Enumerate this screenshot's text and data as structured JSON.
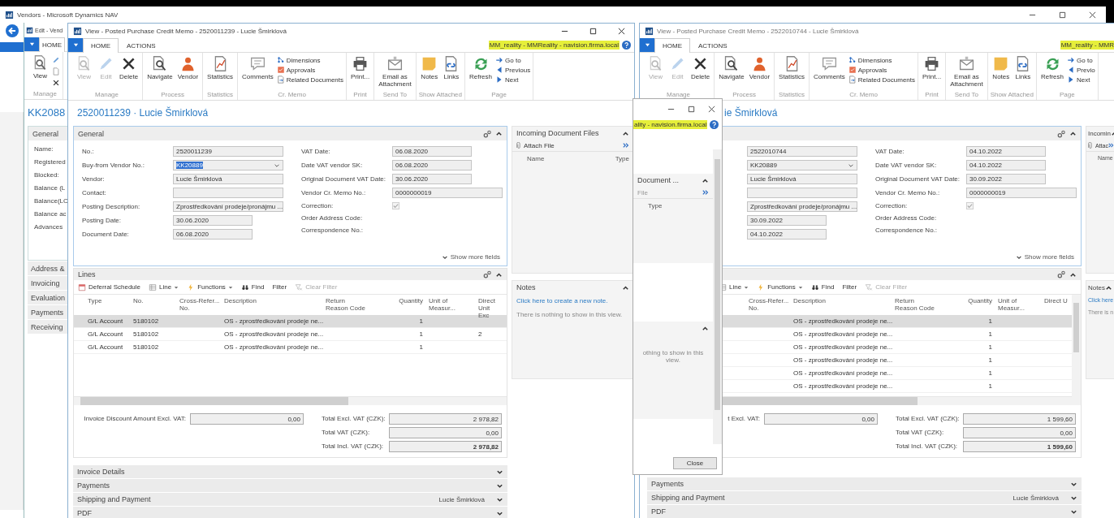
{
  "outer_window": {
    "title": "Vendors - Microsoft Dynamics NAV"
  },
  "vendor_window": {
    "title": "Edit - Vend",
    "tabs": [
      {
        "label": "HOME",
        "selected": true
      }
    ],
    "button": {
      "kind": "view",
      "label": "View"
    },
    "group": "Manage",
    "record": "KK2088",
    "heading": "General",
    "labels": [
      "Name:",
      "Registered",
      "Blocked:",
      "Balance (L",
      "Balance(LC",
      "Balance ac",
      "Advances"
    ],
    "sections": [
      "Address &",
      "Invoicing",
      "Evaluation",
      "Payments",
      "Receiving"
    ]
  },
  "memos": [
    {
      "title": "View - Posted Purchase Credit Memo - 2520011239 - Lucie Šmirklová",
      "tabs": [
        {
          "label": "HOME",
          "selected": true
        },
        {
          "label": "ACTIONS",
          "selected": false
        }
      ],
      "connection": "MM_reality - MMReality - navision.firma.local",
      "ribbon": [
        {
          "label": "Manage",
          "buttons": [
            {
              "kind": "view",
              "label": "View",
              "disabled": true
            },
            {
              "kind": "edit",
              "label": "Edit",
              "disabled": true
            },
            {
              "kind": "delete",
              "label": "Delete",
              "disabled": false
            }
          ]
        },
        {
          "label": "Process",
          "buttons": [
            {
              "kind": "navigate",
              "label": "Navigate",
              "disabled": false
            },
            {
              "kind": "vendor",
              "label": "Vendor",
              "disabled": false
            }
          ]
        },
        {
          "label": "Statistics",
          "buttons": [
            {
              "kind": "statistics",
              "label": "Statistics",
              "disabled": false
            }
          ]
        },
        {
          "label": "Cr. Memo",
          "buttons": [
            {
              "kind": "comments",
              "label": "Comments",
              "disabled": false
            }
          ],
          "small_buttons": [
            {
              "kind": "dimensions",
              "label": "Dimensions"
            },
            {
              "kind": "approvals",
              "label": "Approvals"
            },
            {
              "kind": "related",
              "label": "Related Documents"
            }
          ]
        },
        {
          "label": "Print",
          "buttons": [
            {
              "kind": "print",
              "label": "Print...",
              "disabled": false
            }
          ]
        },
        {
          "label": "Send To",
          "buttons": [
            {
              "kind": "email",
              "label": "Email as\nAttachment",
              "disabled": false
            }
          ]
        },
        {
          "label": "Show Attached",
          "buttons": [
            {
              "kind": "notes",
              "label": "Notes",
              "disabled": false
            },
            {
              "kind": "links",
              "label": "Links",
              "disabled": false
            }
          ]
        },
        {
          "label": "Page",
          "buttons": [
            {
              "kind": "refresh",
              "label": "Refresh",
              "disabled": false
            }
          ],
          "small_buttons": [
            {
              "kind": "goto",
              "label": "Go to"
            },
            {
              "kind": "previous",
              "label": "Previous"
            },
            {
              "kind": "next",
              "label": "Next"
            }
          ]
        }
      ],
      "doc_title": "2520011239 · Lucie Šmirklová",
      "general": {
        "heading": "General",
        "left_fields": [
          {
            "label": "No.:",
            "value": "2520011239",
            "kind": "text",
            "wide": true
          },
          {
            "label": "Buy-from Vendor No.:",
            "value": "KK20889",
            "kind": "dropdown",
            "wide": true,
            "selected": true
          },
          {
            "label": "Vendor:",
            "value": "Lucie Šmirklová",
            "kind": "text",
            "wide": true
          },
          {
            "label": "Contact:",
            "kind": "text",
            "wide": true
          },
          {
            "label": "Posting Description:",
            "value": "Zprostředkování prodeje/pronájmu ...",
            "kind": "text",
            "wide": true
          },
          {
            "label": "Posting Date:",
            "value": "30.06.2020",
            "kind": "text",
            "wide": false
          },
          {
            "label": "Document Date:",
            "value": "06.08.2020",
            "kind": "text",
            "wide": false
          }
        ],
        "right_fields": [
          {
            "label": "VAT Date:",
            "value": "06.08.2020",
            "kind": "text",
            "wide": false
          },
          {
            "label": "Date VAT vendor SK:",
            "value": "06.08.2020",
            "kind": "text",
            "wide": false
          },
          {
            "label": "Original Document VAT Date:",
            "value": "30.06.2020",
            "kind": "text",
            "wide": false
          },
          {
            "label": "Vendor Cr. Memo No.:",
            "value": "0000000019",
            "kind": "text",
            "wide": true
          },
          {
            "label": "Correction:",
            "kind": "checkbox",
            "checked": true
          },
          {
            "label": "Order Address Code:",
            "kind": "none"
          },
          {
            "label": "Correspondence No.:",
            "kind": "none"
          }
        ],
        "show_more": "Show more fields"
      },
      "lines": {
        "heading": "Lines",
        "toolbar": [
          {
            "kind": "deferral",
            "label": "Deferral Schedule",
            "disabled": false
          },
          {
            "kind": "line",
            "label": "Line",
            "menu": true,
            "disabled": false
          },
          {
            "kind": "functions",
            "label": "Functions",
            "menu": true,
            "disabled": false
          },
          {
            "kind": "find",
            "label": "Find",
            "disabled": false
          },
          {
            "kind": "filter",
            "label": "Filter",
            "disabled": false
          },
          {
            "kind": "clear",
            "label": "Clear Filter",
            "disabled": true
          }
        ],
        "columns": [
          {
            "kind": "type",
            "label": "Type"
          },
          {
            "kind": "no",
            "label": "No."
          },
          {
            "kind": "crossref",
            "label": "Cross-Refer...\nNo."
          },
          {
            "kind": "description",
            "label": "Description"
          },
          {
            "kind": "reason",
            "label": "Return\nReason Code"
          },
          {
            "kind": "quantity",
            "label": "Quantity"
          },
          {
            "kind": "unit",
            "label": "Unit of\nMeasur..."
          },
          {
            "kind": "direct",
            "label": "Direct Unit\nExc"
          }
        ],
        "rows": [
          {
            "selected": true,
            "cells": [
              "G/L Account",
              "5180102",
              "",
              "OS - zprostředkování prodeje ne...",
              "",
              "1",
              "",
              ""
            ]
          },
          {
            "selected": false,
            "cells": [
              "G/L Account",
              "5180102",
              "",
              "OS - zprostředkování prodeje ne...",
              "",
              "1",
              "",
              "2"
            ]
          },
          {
            "selected": false,
            "cells": [
              "G/L Account",
              "5180102",
              "",
              "OS - zprostředkování prodeje ne...",
              "",
              "1",
              "",
              ""
            ]
          }
        ]
      },
      "totals": {
        "discount_label": "Invoice Discount Amount Excl. VAT:",
        "discount_value": "0,00",
        "rows": [
          {
            "label": "Total Excl. VAT (CZK):",
            "value": "2 978,82",
            "bold": false
          },
          {
            "label": "Total VAT (CZK):",
            "value": "0,00",
            "bold": false
          },
          {
            "label": "Total Incl. VAT (CZK):",
            "value": "2 978,82",
            "bold": true
          }
        ]
      },
      "sections": [
        {
          "title": "Invoice Details"
        },
        {
          "title": "Payments"
        },
        {
          "title": "Shipping and Payment",
          "value": "Lucie Šmirklová"
        },
        {
          "title": "PDF"
        }
      ],
      "factbox": [
        {
          "kind": "files",
          "title": "Incoming Document Files",
          "action": "Attach File",
          "columns": [
            "Name",
            "Type"
          ]
        },
        {
          "kind": "notes",
          "title": "Notes",
          "link": "Click here to create a new note.",
          "empty": "There is nothing to show in this view."
        }
      ]
    },
    {
      "title": "View - Posted Purchase Credit Memo - 2522010744 - Lucie Šmirklová",
      "tabs": [
        {
          "label": "HOME",
          "selected": true
        },
        {
          "label": "ACTIONS",
          "selected": false
        }
      ],
      "connection": "MM_reality - MMR",
      "ribbon": [
        {
          "label": "Manage",
          "buttons": [
            {
              "kind": "view",
              "label": "View",
              "disabled": true
            },
            {
              "kind": "edit",
              "label": "Edit",
              "disabled": true
            },
            {
              "kind": "delete",
              "label": "Delete",
              "disabled": false
            }
          ]
        },
        {
          "label": "Process",
          "buttons": [
            {
              "kind": "navigate",
              "label": "Navigate",
              "disabled": false
            },
            {
              "kind": "vendor",
              "label": "Vendor",
              "disabled": false
            }
          ]
        },
        {
          "label": "Statistics",
          "buttons": [
            {
              "kind": "statistics",
              "label": "Statistics",
              "disabled": false
            }
          ]
        },
        {
          "label": "Cr. Memo",
          "buttons": [
            {
              "kind": "comments",
              "label": "Comments",
              "disabled": false
            }
          ],
          "small_buttons": [
            {
              "kind": "dimensions",
              "label": "Dimensions"
            },
            {
              "kind": "approvals",
              "label": "Approvals"
            },
            {
              "kind": "related",
              "label": "Related Documents"
            }
          ]
        },
        {
          "label": "Print",
          "buttons": [
            {
              "kind": "print",
              "label": "Print...",
              "disabled": false
            }
          ]
        },
        {
          "label": "Send To",
          "buttons": [
            {
              "kind": "email",
              "label": "Email as\nAttachment",
              "disabled": false
            }
          ]
        },
        {
          "label": "Show Attached",
          "buttons": [
            {
              "kind": "notes",
              "label": "Notes",
              "disabled": false
            },
            {
              "kind": "links",
              "label": "Links",
              "disabled": false
            }
          ]
        },
        {
          "label": "Page",
          "buttons": [
            {
              "kind": "refresh",
              "label": "Refresh",
              "disabled": false
            }
          ],
          "small_buttons": [
            {
              "kind": "goto",
              "label": "Go to"
            },
            {
              "kind": "previous",
              "label": "Previo"
            },
            {
              "kind": "next",
              "label": "Next"
            }
          ]
        }
      ],
      "doc_title": "ie Šmirklová",
      "general": {
        "left_fields": [
          {
            "value": "2522010744",
            "kind": "text",
            "wide": true
          },
          {
            "value": "KK20889",
            "kind": "dropdown",
            "wide": true,
            "selected": false
          },
          {
            "value": "Lucie Šmirklová",
            "kind": "text",
            "wide": true
          },
          {
            "kind": "text",
            "wide": true
          },
          {
            "value": "Zprostředkování prodeje/pronájmu ...",
            "kind": "text",
            "wide": true
          },
          {
            "value": "30.09.2022",
            "kind": "text",
            "wide": false
          },
          {
            "value": "04.10.2022",
            "kind": "text",
            "wide": false
          }
        ],
        "right_fields": [
          {
            "label": "VAT Date:",
            "value": "04.10.2022",
            "kind": "text",
            "wide": false
          },
          {
            "label": "Date VAT vendor SK:",
            "value": "04.10.2022",
            "kind": "text",
            "wide": false
          },
          {
            "label": "Original Document VAT Date:",
            "value": "30.09.2022",
            "kind": "text",
            "wide": false
          },
          {
            "label": "Vendor Cr. Memo No.:",
            "value": "0000000019",
            "kind": "text",
            "wide": true
          },
          {
            "label": "Correction:",
            "kind": "checkbox",
            "checked": true
          },
          {
            "label": "Order Address Code:",
            "kind": "none"
          },
          {
            "label": "Correspondence No.:",
            "kind": "none"
          }
        ],
        "show_more": "Show more fields"
      },
      "lines": {
        "toolbar": [
          {
            "kind": "line",
            "label": "Line",
            "menu": true,
            "disabled": false
          },
          {
            "kind": "functions",
            "label": "Functions",
            "menu": true,
            "disabled": false
          },
          {
            "kind": "find",
            "label": "Find",
            "disabled": false
          },
          {
            "kind": "filter",
            "label": "Filter",
            "disabled": false
          },
          {
            "kind": "clear",
            "label": "Clear Filter",
            "disabled": true
          }
        ],
        "columns": [
          {
            "kind": "crossref",
            "label": "Cross-Refer...\nNo."
          },
          {
            "kind": "description",
            "label": "Description"
          },
          {
            "kind": "reason",
            "label": "Return\nReason Code"
          },
          {
            "kind": "quantity",
            "label": "Quantity"
          },
          {
            "kind": "unit",
            "label": "Unit of\nMeasur..."
          },
          {
            "kind": "direct",
            "label": "Direct U"
          }
        ],
        "rows": [
          {
            "selected": true,
            "cells": [
              "",
              "OS - zprostředkování prodeje ne...",
              "",
              "1",
              "",
              ""
            ]
          },
          {
            "selected": false,
            "cells": [
              "",
              "OS - zprostředkování prodeje ne...",
              "",
              "1",
              "",
              ""
            ]
          },
          {
            "selected": false,
            "cells": [
              "",
              "OS - zprostředkování prodeje ne...",
              "",
              "1",
              "",
              ""
            ]
          },
          {
            "selected": false,
            "cells": [
              "",
              "OS - zprostředkování prodeje ne...",
              "",
              "1",
              "",
              ""
            ]
          },
          {
            "selected": false,
            "cells": [
              "",
              "OS - zprostředkování prodeje ne...",
              "",
              "1",
              "",
              ""
            ]
          },
          {
            "selected": false,
            "cells": [
              "",
              "OS - zprostředkování prodeje ne...",
              "",
              "1",
              "",
              ""
            ]
          }
        ]
      },
      "totals": {
        "discount_label": "t Excl. VAT:",
        "discount_value": "0,00",
        "rows": [
          {
            "label": "Total Excl. VAT (CZK):",
            "value": "1 599,60",
            "bold": false
          },
          {
            "label": "Total VAT (CZK):",
            "value": "0,00",
            "bold": false
          },
          {
            "label": "Total Incl. VAT (CZK):",
            "value": "1 599,60",
            "bold": true
          }
        ]
      },
      "sections": [
        {
          "title": "Payments"
        },
        {
          "title": "Shipping and Payment",
          "value": "Lucie Šmirklová"
        },
        {
          "title": "PDF"
        }
      ],
      "factbox": [
        {
          "kind": "files",
          "title": "Incomin",
          "action": "Attac",
          "columns": [
            "Name"
          ]
        },
        {
          "kind": "notes",
          "title": "Notes",
          "link": "Click here",
          "empty": "There is n"
        }
      ]
    }
  ],
  "dialog": {
    "connection": "ality - navision.firma.local",
    "panel_title": "Document ...",
    "panel_action": "File",
    "column": "Type",
    "empty": "othing to show in this view.",
    "button": "Close"
  }
}
